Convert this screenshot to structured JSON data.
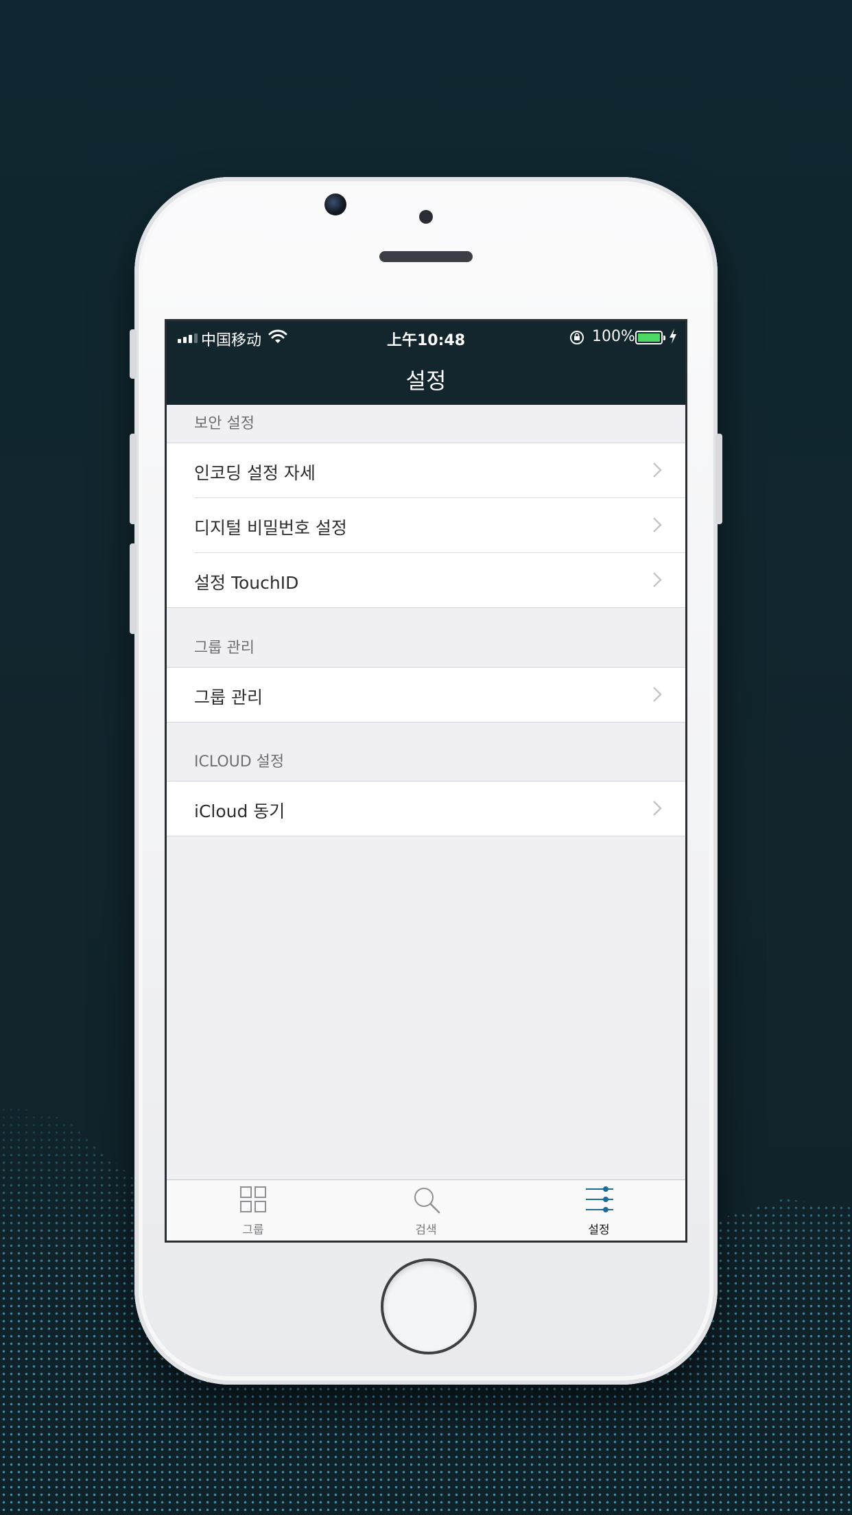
{
  "status_bar": {
    "carrier": "中国移动",
    "time": "上午10:48",
    "battery_percent": "100%",
    "battery_level": 1.0,
    "battery_color": "#4cd964"
  },
  "nav": {
    "title": "설정"
  },
  "sections": [
    {
      "header": "보안 설정",
      "rows": [
        "인코딩 설정 자세",
        "디지털 비밀번호 설정",
        "설정 TouchID"
      ]
    },
    {
      "header": "그룹 관리",
      "rows": [
        "그룹 관리"
      ]
    },
    {
      "header": "ICLOUD 설정",
      "rows": [
        "iCloud 동기"
      ]
    }
  ],
  "tabbar": {
    "tabs": [
      {
        "label": "그룹",
        "icon": "grid-icon",
        "active": false
      },
      {
        "label": "검색",
        "icon": "search-icon",
        "active": false
      },
      {
        "label": "설정",
        "icon": "sliders-icon",
        "active": true
      }
    ]
  },
  "colors": {
    "nav_bg": "#13262e",
    "accent": "#1e6b9a",
    "background": "#efeff4"
  }
}
